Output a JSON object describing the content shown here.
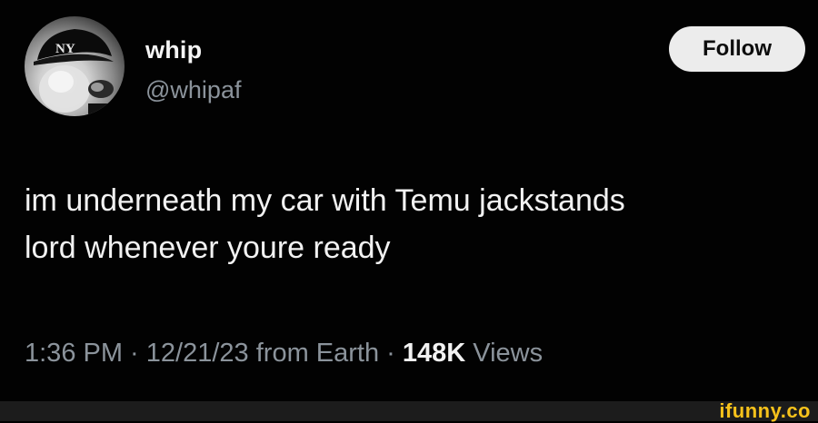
{
  "author": {
    "display_name": "whip",
    "handle": "@whipaf",
    "avatar_icon": "profile-photo-avatar"
  },
  "follow_button": {
    "label": "Follow"
  },
  "tweet": {
    "text_line_1": "im underneath my car with Temu jackstands",
    "text_line_2": "lord whenever youre ready"
  },
  "meta": {
    "time": "1:36 PM",
    "separator": " · ",
    "date": "12/21/23",
    "source": "from Earth",
    "views_count": "148K",
    "views_label": "Views"
  },
  "watermark": {
    "text": "ifunny.co",
    "color": "#f7c21b"
  }
}
